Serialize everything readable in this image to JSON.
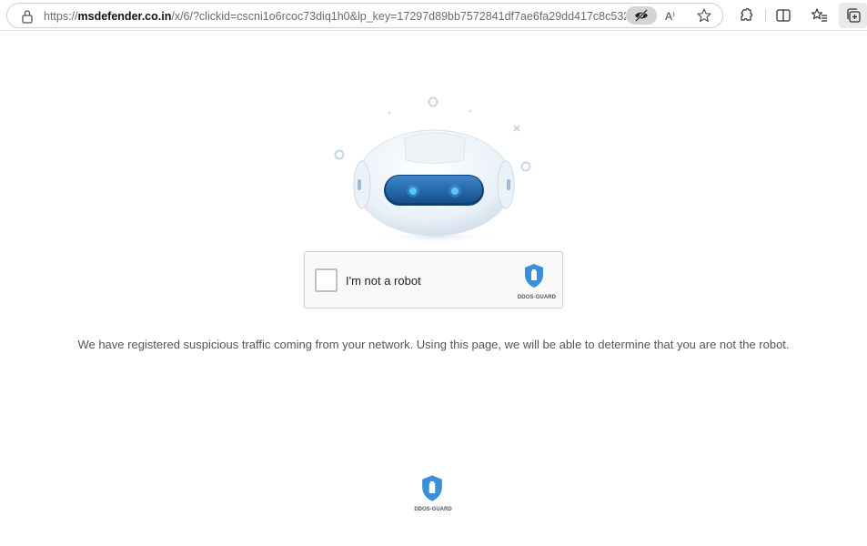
{
  "browser": {
    "url_prefix": "https://",
    "url_host": "msdefender.co.in",
    "url_rest": "/x/6/?clickid=cscni1o6rcoc73diq1h0&lp_key=17297d89bb7572841df7ae6fa29dd417c8c532...",
    "read_aloud_label": "A⁾",
    "icons": [
      "lock-icon",
      "tracking-prevention-icon",
      "read-aloud-icon",
      "favorite-star-icon",
      "extensions-icon",
      "split-screen-icon",
      "favorites-icon",
      "collections-icon"
    ]
  },
  "captcha": {
    "label": "I'm not a robot",
    "brand": "DDOS-GUARD",
    "checked": false
  },
  "message": "We have registered suspicious traffic coming from your network. Using this page, we will be able to determine that you are not the robot.",
  "footer": {
    "brand": "DDOS-GUARD"
  },
  "colors": {
    "brand_blue": "#3a8fd6",
    "robot_visor": "#1f5fa0",
    "robot_eye": "#56c8f5"
  }
}
